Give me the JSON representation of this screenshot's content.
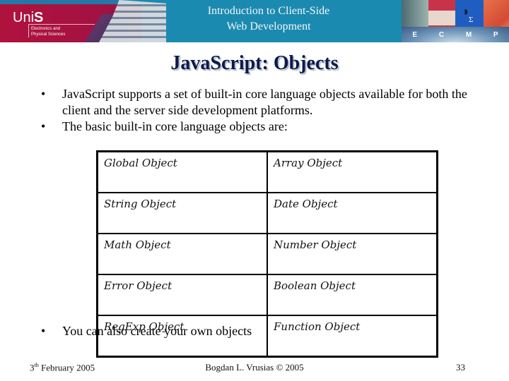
{
  "header": {
    "logo_text_light": "Uni",
    "logo_text_bold": "S",
    "logo_subtitle_line1": "Electronics and",
    "logo_subtitle_line2": "Physical Sciences",
    "course_title_line1": "Introduction to Client-Side",
    "course_title_line2": "Web Development",
    "collage_letters": [
      "E",
      "C",
      "M",
      "P"
    ]
  },
  "slide": {
    "title": "JavaScript: Objects",
    "bullets": [
      "JavaScript supports a set of built-in core language objects available for both the client and the server side development platforms.",
      "The basic built-in core language objects are:"
    ],
    "table": [
      [
        "Global Object",
        "Array Object"
      ],
      [
        "String Object",
        "Date Object"
      ],
      [
        "Math Object",
        "Number Object"
      ],
      [
        "Error Object",
        "Boolean Object"
      ],
      [
        "RegExp Object",
        "Function Object"
      ]
    ],
    "final_bullet": "You can also create your own objects",
    "bullet_glyph": "•"
  },
  "footer": {
    "date_day": "3",
    "date_suffix": "th",
    "date_rest": " February 2005",
    "author": "Bogdan L. Vrusias © 2005",
    "page_number": "33"
  }
}
